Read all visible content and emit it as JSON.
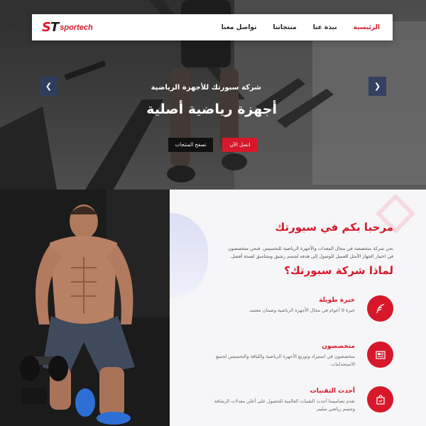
{
  "brand": {
    "mark_s": "S",
    "mark_t": "T",
    "name": "sportech"
  },
  "nav": {
    "items": [
      {
        "label": "الرئيسية",
        "active": true
      },
      {
        "label": "نبذة عنا",
        "active": false
      },
      {
        "label": "منتجاتنا",
        "active": false
      },
      {
        "label": "تواصل معنا",
        "active": false
      }
    ]
  },
  "hero": {
    "subtitle": "شركة سبورتك للأجهزة الرياضية",
    "title": "أجهزة رياضية أصلية",
    "primary_button": "اتصل الآن",
    "secondary_button": "تصفح المنتجات",
    "prev_arrow": "❮",
    "next_arrow": "❯"
  },
  "welcome": {
    "title": "مرحبا بكم في سبورتك",
    "text": "نحن شركة متخصصة في مجال المعدات والأجهزة الرياضية للتخسيس. فنحن متخصصون في اختيار الجهاز الأمثل للعميل للوصول إلى هدفه لجسم رشيق ومتناسق لصحة أفضل."
  },
  "why": {
    "title": "لماذا شركة سبورتك؟",
    "features": [
      {
        "title": "خبرة طويلة",
        "text": "خبرة 9 أعوام في مجال الأجهزة الرياضية وضمان معتمد.",
        "icon": "feather-icon"
      },
      {
        "title": "متخصصون",
        "text": "متخصصون في استيراد وتوزيع الأجهزة الرياضية واللياقة والتخسيس لجميع الاستخدامات.",
        "icon": "newspaper-icon"
      },
      {
        "title": "أحدث التقنيات",
        "text": "نقدم تصاميمنا أحدث التقنيات العالمية للحصول على أعلى معدلات الرشاقة وجسم رياضي سليم.",
        "icon": "shopping-bag-icon"
      }
    ]
  },
  "colors": {
    "accent": "#d7182a",
    "dark": "#111111",
    "arrow_bg": "#2d3e60"
  }
}
